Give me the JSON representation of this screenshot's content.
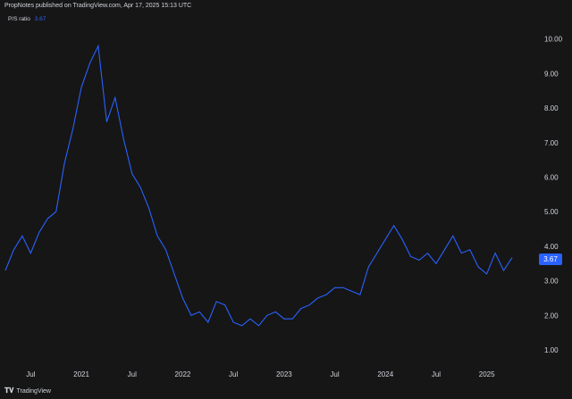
{
  "header": {
    "text": "PropNotes published on TradingView.com, Apr 17, 2025 15:13 UTC"
  },
  "legend": {
    "name": "P/S ratio",
    "value": "3.67"
  },
  "footer": {
    "brand": "TradingView",
    "logo": "tradingview-logo-icon"
  },
  "colors": {
    "line": "#2962ff",
    "background": "#161616",
    "text": "#d1d4dc"
  },
  "chart_data": {
    "type": "line",
    "series": [
      {
        "name": "P/S ratio",
        "x": [
          "2020-04",
          "2020-05",
          "2020-06",
          "2020-07",
          "2020-08",
          "2020-09",
          "2020-10",
          "2020-11",
          "2020-12",
          "2021-01",
          "2021-02",
          "2021-03",
          "2021-04",
          "2021-05",
          "2021-06",
          "2021-07",
          "2021-08",
          "2021-09",
          "2021-10",
          "2021-11",
          "2021-12",
          "2022-01",
          "2022-02",
          "2022-03",
          "2022-04",
          "2022-05",
          "2022-06",
          "2022-07",
          "2022-08",
          "2022-09",
          "2022-10",
          "2022-11",
          "2022-12",
          "2023-01",
          "2023-02",
          "2023-03",
          "2023-04",
          "2023-05",
          "2023-06",
          "2023-07",
          "2023-08",
          "2023-09",
          "2023-10",
          "2023-11",
          "2023-12",
          "2024-01",
          "2024-02",
          "2024-03",
          "2024-04",
          "2024-05",
          "2024-06",
          "2024-07",
          "2024-08",
          "2024-09",
          "2024-10",
          "2024-11",
          "2024-12",
          "2025-01",
          "2025-02",
          "2025-03",
          "2025-04"
        ],
        "values": [
          3.3,
          3.9,
          4.3,
          3.8,
          4.4,
          4.8,
          5.0,
          6.4,
          7.4,
          8.6,
          9.3,
          9.8,
          7.6,
          8.3,
          7.1,
          6.1,
          5.7,
          5.1,
          4.3,
          3.9,
          3.2,
          2.5,
          2.0,
          2.1,
          1.8,
          2.4,
          2.3,
          1.8,
          1.7,
          1.9,
          1.7,
          2.0,
          2.1,
          1.9,
          1.9,
          2.2,
          2.3,
          2.5,
          2.6,
          2.8,
          2.8,
          2.7,
          2.6,
          3.4,
          3.8,
          4.2,
          4.6,
          4.2,
          3.7,
          3.6,
          3.8,
          3.5,
          3.9,
          4.3,
          3.8,
          3.9,
          3.4,
          3.2,
          3.8,
          3.3,
          3.67
        ]
      }
    ],
    "x_ticks": [
      "Jul",
      "2021",
      "Jul",
      "2022",
      "Jul",
      "2023",
      "Jul",
      "2024",
      "Jul",
      "2025"
    ],
    "y_ticks": [
      "1.00",
      "2.00",
      "3.00",
      "4.00",
      "5.00",
      "6.00",
      "7.00",
      "8.00",
      "9.00",
      "10.00"
    ],
    "ylim": [
      0.6,
      10.4
    ],
    "last_value": "3.67",
    "grid": false,
    "legend_position": "top-left"
  }
}
